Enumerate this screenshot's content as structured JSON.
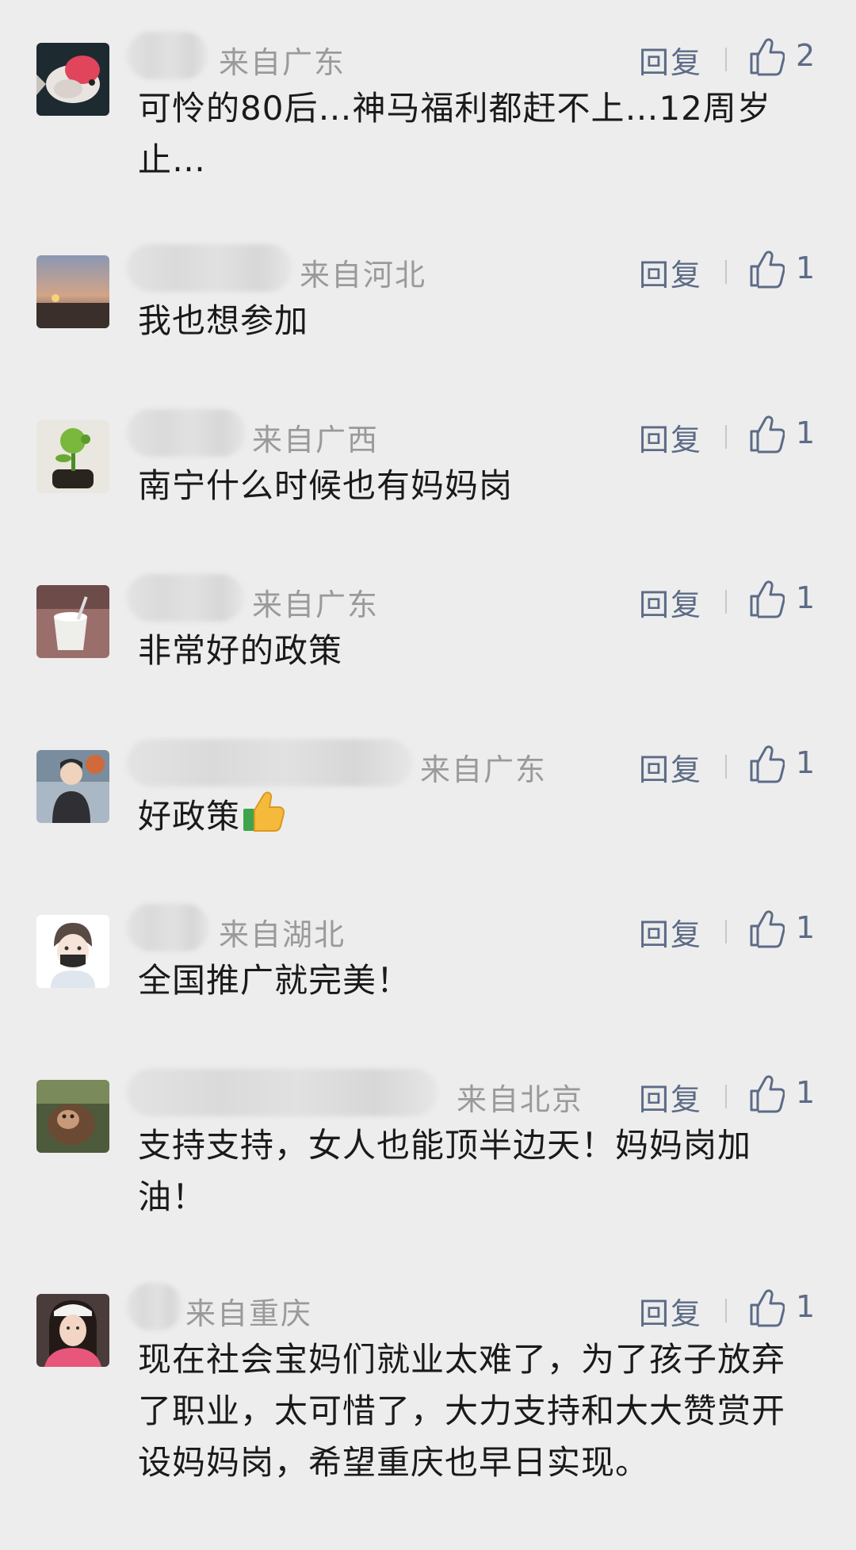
{
  "reply_label": "回复",
  "comments": [
    {
      "avatar": "goldfish-avatar",
      "location": "来自广东",
      "text": "可怜的80后…神马福利都赶不上…12周岁止…",
      "likes": "2"
    },
    {
      "avatar": "sunset-avatar",
      "location": "来自河北",
      "text": "我也想参加",
      "likes": "1"
    },
    {
      "avatar": "peashooter-plant-avatar",
      "location": "来自广西",
      "text": "南宁什么时候也有妈妈岗",
      "likes": "1"
    },
    {
      "avatar": "milk-cup-avatar",
      "location": "来自广东",
      "text": "非常好的政策",
      "likes": "1"
    },
    {
      "avatar": "person-avatar",
      "location": "来自广东",
      "text": "好政策",
      "emoji": "thumbs-up-emoji",
      "likes": "1"
    },
    {
      "avatar": "masked-boy-avatar",
      "location": "来自湖北",
      "text": "全国推广就完美！",
      "likes": "1"
    },
    {
      "avatar": "monkey-avatar",
      "location": "来自北京",
      "text": "支持支持，女人也能顶半边天！妈妈岗加油！",
      "likes": "1"
    },
    {
      "avatar": "woman-avatar",
      "location": "来自重庆",
      "text": "现在社会宝妈们就业太难了，为了孩子放弃了职业，太可惜了，大力支持和大大赞赏开设妈妈岗，希望重庆也早日实现。",
      "likes": "1"
    }
  ]
}
